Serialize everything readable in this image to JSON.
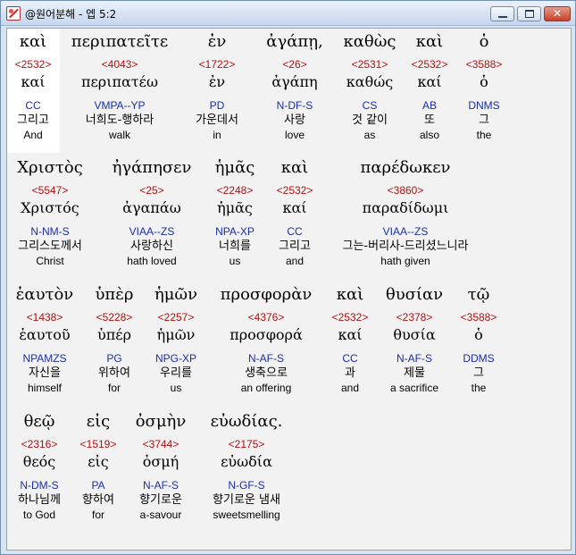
{
  "window": {
    "title": "@원어분해 - 엡 5:2",
    "close_label": "✕"
  },
  "rows": [
    [
      {
        "g": "καὶ",
        "s": "<2532>",
        "l": "καί",
        "p": "CC",
        "k": "그리고",
        "e": "And"
      },
      {
        "g": "περιπατεῖτε",
        "s": "<4043>",
        "l": "περιπατέω",
        "p": "VMPA--YP",
        "k": "너희도-행하라",
        "e": "walk"
      },
      {
        "g": "ἐν",
        "s": "<1722>",
        "l": "ἐν",
        "p": "PD",
        "k": "가운데서",
        "e": "in"
      },
      {
        "g": "ἀγάπῃ,",
        "s": "<26>",
        "l": "ἀγάπη",
        "p": "N-DF-S",
        "k": "사랑",
        "e": "love"
      },
      {
        "g": "καθὼς",
        "s": "<2531>",
        "l": "καθώς",
        "p": "CS",
        "k": "것 같이",
        "e": "as"
      },
      {
        "g": "καὶ",
        "s": "<2532>",
        "l": "καί",
        "p": "AB",
        "k": "또",
        "e": "also"
      },
      {
        "g": "ὁ",
        "s": "<3588>",
        "l": "ὁ",
        "p": "DNMS",
        "k": "그",
        "e": "the"
      }
    ],
    [
      {
        "g": "Χριστὸς",
        "s": "<5547>",
        "l": "Χριστός",
        "p": "N-NM-S",
        "k": "그리스도께서",
        "e": "Christ"
      },
      {
        "g": "ἠγάπησεν",
        "s": "<25>",
        "l": "ἀγαπάω",
        "p": "VIAA--ZS",
        "k": "사랑하신",
        "e": "hath loved"
      },
      {
        "g": "ἡμᾶς",
        "s": "<2248>",
        "l": "ἡμᾶς",
        "p": "NPA-XP",
        "k": "너희를",
        "e": "us"
      },
      {
        "g": "καὶ",
        "s": "<2532>",
        "l": "καί",
        "p": "CC",
        "k": "그리고",
        "e": "and"
      },
      {
        "g": "παρέδωκεν",
        "s": "<3860>",
        "l": "παραδίδωμι",
        "p": "VIAA--ZS",
        "k": "그는-버리사-드리셨느니라",
        "e": "hath given"
      }
    ],
    [
      {
        "g": "ἑαυτὸν",
        "s": "<1438>",
        "l": "ἑαυτοῦ",
        "p": "NPAMZS",
        "k": "자신을",
        "e": "himself"
      },
      {
        "g": "ὑπὲρ",
        "s": "<5228>",
        "l": "ὑπέρ",
        "p": "PG",
        "k": "위하여",
        "e": "for"
      },
      {
        "g": "ἡμῶν",
        "s": "<2257>",
        "l": "ἡμῶν",
        "p": "NPG-XP",
        "k": "우리를",
        "e": "us"
      },
      {
        "g": "προσφορὰν",
        "s": "<4376>",
        "l": "προσφορά",
        "p": "N-AF-S",
        "k": "생축으로",
        "e": "an offering"
      },
      {
        "g": "καὶ",
        "s": "<2532>",
        "l": "καί",
        "p": "CC",
        "k": "과",
        "e": "and"
      },
      {
        "g": "θυσίαν",
        "s": "<2378>",
        "l": "θυσία",
        "p": "N-AF-S",
        "k": "제물",
        "e": "a sacrifice"
      },
      {
        "g": "τῷ",
        "s": "<3588>",
        "l": "ὁ",
        "p": "DDMS",
        "k": "그",
        "e": "the"
      }
    ],
    [
      {
        "g": "θεῷ",
        "s": "<2316>",
        "l": "θεός",
        "p": "N-DM-S",
        "k": "하나님께",
        "e": "to God"
      },
      {
        "g": "εἰς",
        "s": "<1519>",
        "l": "εἰς",
        "p": "PA",
        "k": "향하여",
        "e": "for"
      },
      {
        "g": "ὀσμὴν",
        "s": "<3744>",
        "l": "ὀσμή",
        "p": "N-AF-S",
        "k": "향기로운",
        "e": "a-savour"
      },
      {
        "g": "εὐωδίας.",
        "s": "<2175>",
        "l": "εὐωδία",
        "p": "N-GF-S",
        "k": "향기로운 냄새",
        "e": "sweetsmelling"
      }
    ]
  ]
}
